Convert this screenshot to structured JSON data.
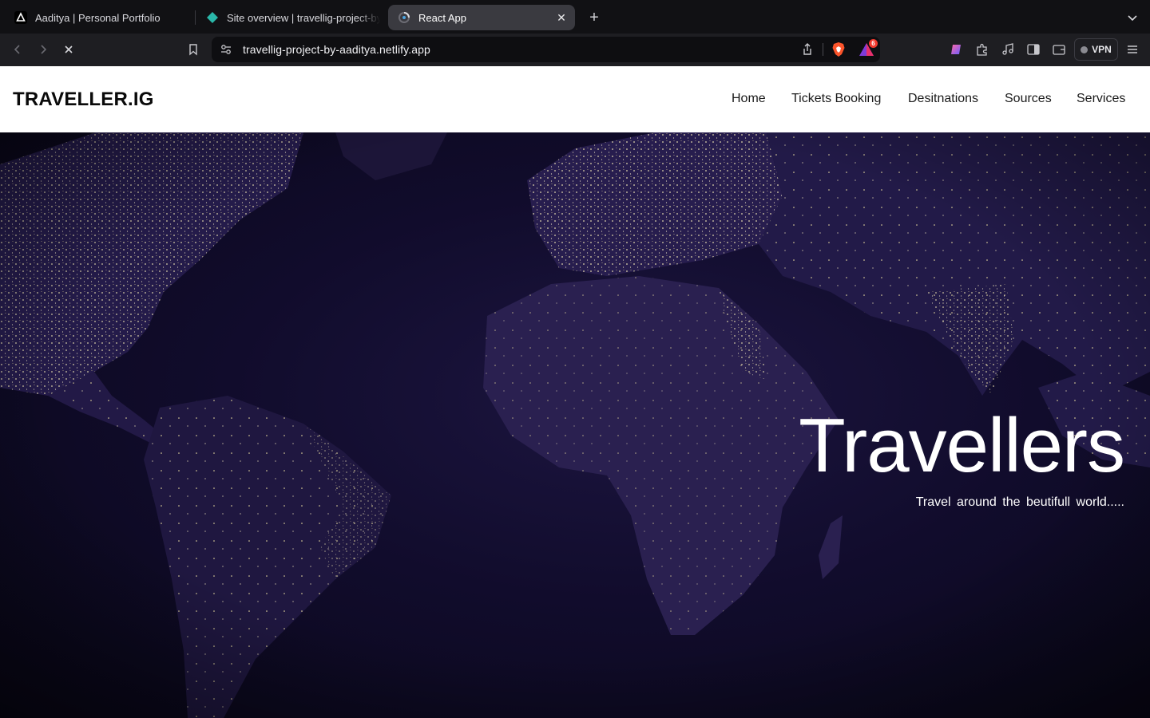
{
  "browser": {
    "tabs": [
      {
        "title": "Aaditya | Personal Portfolio",
        "icon": "portfolio-logo-icon"
      },
      {
        "title": "Site overview | travellig-project-by-aaditya",
        "icon": "netlify-diamond-icon"
      },
      {
        "title": "React App",
        "icon": "loading-spinner-icon",
        "active": true
      }
    ],
    "url": "travellig-project-by-aaditya.netlify.app",
    "rewards_badge": "6",
    "vpn_label": "VPN",
    "accent": "#2ab7a9"
  },
  "site": {
    "logo": "TRAVELLER.IG",
    "nav": [
      "Home",
      "Tickets Booking",
      "Desitnations",
      "Sources",
      "Services"
    ],
    "hero": {
      "title": "Travellers",
      "subtitle": "Travel around  the  beutifull  world....."
    }
  }
}
